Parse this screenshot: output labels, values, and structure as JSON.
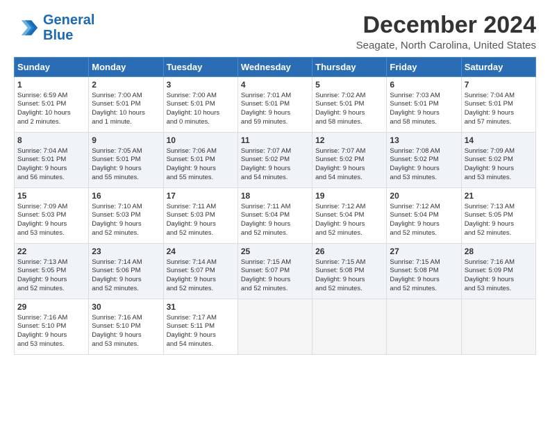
{
  "header": {
    "logo_line1": "General",
    "logo_line2": "Blue",
    "month": "December 2024",
    "location": "Seagate, North Carolina, United States"
  },
  "weekdays": [
    "Sunday",
    "Monday",
    "Tuesday",
    "Wednesday",
    "Thursday",
    "Friday",
    "Saturday"
  ],
  "weeks": [
    [
      {
        "day": "1",
        "lines": [
          "Sunrise: 6:59 AM",
          "Sunset: 5:01 PM",
          "Daylight: 10 hours",
          "and 2 minutes."
        ]
      },
      {
        "day": "2",
        "lines": [
          "Sunrise: 7:00 AM",
          "Sunset: 5:01 PM",
          "Daylight: 10 hours",
          "and 1 minute."
        ]
      },
      {
        "day": "3",
        "lines": [
          "Sunrise: 7:00 AM",
          "Sunset: 5:01 PM",
          "Daylight: 10 hours",
          "and 0 minutes."
        ]
      },
      {
        "day": "4",
        "lines": [
          "Sunrise: 7:01 AM",
          "Sunset: 5:01 PM",
          "Daylight: 9 hours",
          "and 59 minutes."
        ]
      },
      {
        "day": "5",
        "lines": [
          "Sunrise: 7:02 AM",
          "Sunset: 5:01 PM",
          "Daylight: 9 hours",
          "and 58 minutes."
        ]
      },
      {
        "day": "6",
        "lines": [
          "Sunrise: 7:03 AM",
          "Sunset: 5:01 PM",
          "Daylight: 9 hours",
          "and 58 minutes."
        ]
      },
      {
        "day": "7",
        "lines": [
          "Sunrise: 7:04 AM",
          "Sunset: 5:01 PM",
          "Daylight: 9 hours",
          "and 57 minutes."
        ]
      }
    ],
    [
      {
        "day": "8",
        "lines": [
          "Sunrise: 7:04 AM",
          "Sunset: 5:01 PM",
          "Daylight: 9 hours",
          "and 56 minutes."
        ]
      },
      {
        "day": "9",
        "lines": [
          "Sunrise: 7:05 AM",
          "Sunset: 5:01 PM",
          "Daylight: 9 hours",
          "and 55 minutes."
        ]
      },
      {
        "day": "10",
        "lines": [
          "Sunrise: 7:06 AM",
          "Sunset: 5:01 PM",
          "Daylight: 9 hours",
          "and 55 minutes."
        ]
      },
      {
        "day": "11",
        "lines": [
          "Sunrise: 7:07 AM",
          "Sunset: 5:02 PM",
          "Daylight: 9 hours",
          "and 54 minutes."
        ]
      },
      {
        "day": "12",
        "lines": [
          "Sunrise: 7:07 AM",
          "Sunset: 5:02 PM",
          "Daylight: 9 hours",
          "and 54 minutes."
        ]
      },
      {
        "day": "13",
        "lines": [
          "Sunrise: 7:08 AM",
          "Sunset: 5:02 PM",
          "Daylight: 9 hours",
          "and 53 minutes."
        ]
      },
      {
        "day": "14",
        "lines": [
          "Sunrise: 7:09 AM",
          "Sunset: 5:02 PM",
          "Daylight: 9 hours",
          "and 53 minutes."
        ]
      }
    ],
    [
      {
        "day": "15",
        "lines": [
          "Sunrise: 7:09 AM",
          "Sunset: 5:03 PM",
          "Daylight: 9 hours",
          "and 53 minutes."
        ]
      },
      {
        "day": "16",
        "lines": [
          "Sunrise: 7:10 AM",
          "Sunset: 5:03 PM",
          "Daylight: 9 hours",
          "and 52 minutes."
        ]
      },
      {
        "day": "17",
        "lines": [
          "Sunrise: 7:11 AM",
          "Sunset: 5:03 PM",
          "Daylight: 9 hours",
          "and 52 minutes."
        ]
      },
      {
        "day": "18",
        "lines": [
          "Sunrise: 7:11 AM",
          "Sunset: 5:04 PM",
          "Daylight: 9 hours",
          "and 52 minutes."
        ]
      },
      {
        "day": "19",
        "lines": [
          "Sunrise: 7:12 AM",
          "Sunset: 5:04 PM",
          "Daylight: 9 hours",
          "and 52 minutes."
        ]
      },
      {
        "day": "20",
        "lines": [
          "Sunrise: 7:12 AM",
          "Sunset: 5:04 PM",
          "Daylight: 9 hours",
          "and 52 minutes."
        ]
      },
      {
        "day": "21",
        "lines": [
          "Sunrise: 7:13 AM",
          "Sunset: 5:05 PM",
          "Daylight: 9 hours",
          "and 52 minutes."
        ]
      }
    ],
    [
      {
        "day": "22",
        "lines": [
          "Sunrise: 7:13 AM",
          "Sunset: 5:05 PM",
          "Daylight: 9 hours",
          "and 52 minutes."
        ]
      },
      {
        "day": "23",
        "lines": [
          "Sunrise: 7:14 AM",
          "Sunset: 5:06 PM",
          "Daylight: 9 hours",
          "and 52 minutes."
        ]
      },
      {
        "day": "24",
        "lines": [
          "Sunrise: 7:14 AM",
          "Sunset: 5:07 PM",
          "Daylight: 9 hours",
          "and 52 minutes."
        ]
      },
      {
        "day": "25",
        "lines": [
          "Sunrise: 7:15 AM",
          "Sunset: 5:07 PM",
          "Daylight: 9 hours",
          "and 52 minutes."
        ]
      },
      {
        "day": "26",
        "lines": [
          "Sunrise: 7:15 AM",
          "Sunset: 5:08 PM",
          "Daylight: 9 hours",
          "and 52 minutes."
        ]
      },
      {
        "day": "27",
        "lines": [
          "Sunrise: 7:15 AM",
          "Sunset: 5:08 PM",
          "Daylight: 9 hours",
          "and 52 minutes."
        ]
      },
      {
        "day": "28",
        "lines": [
          "Sunrise: 7:16 AM",
          "Sunset: 5:09 PM",
          "Daylight: 9 hours",
          "and 53 minutes."
        ]
      }
    ],
    [
      {
        "day": "29",
        "lines": [
          "Sunrise: 7:16 AM",
          "Sunset: 5:10 PM",
          "Daylight: 9 hours",
          "and 53 minutes."
        ]
      },
      {
        "day": "30",
        "lines": [
          "Sunrise: 7:16 AM",
          "Sunset: 5:10 PM",
          "Daylight: 9 hours",
          "and 53 minutes."
        ]
      },
      {
        "day": "31",
        "lines": [
          "Sunrise: 7:17 AM",
          "Sunset: 5:11 PM",
          "Daylight: 9 hours",
          "and 54 minutes."
        ]
      },
      null,
      null,
      null,
      null
    ]
  ]
}
